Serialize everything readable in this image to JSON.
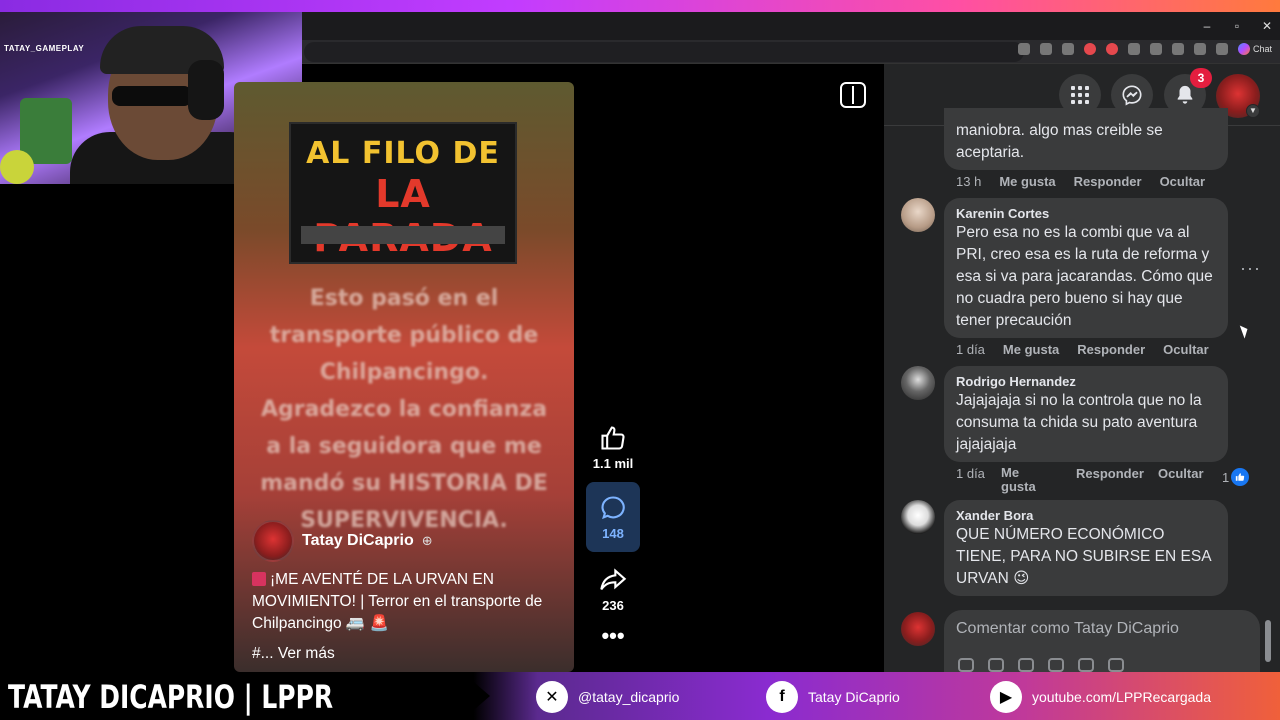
{
  "window": {
    "minimize": "–",
    "restore": "▫",
    "close": "✕"
  },
  "browser": {
    "chat_label": "Chat"
  },
  "webcam": {
    "label": "TATAY_GAMEPLAY"
  },
  "post": {
    "poster_line1": "AL FILO DE",
    "poster_line2": "LA PARADA",
    "overlay_text": "Esto pasó en el transporte público de Chilpancingo. Agradezco la confianza a la seguidora que me mandó su HISTORIA DE SUPERVIVENCIA.",
    "author": "Tatay DiCaprio",
    "caption": "¡ME AVENTÉ DE LA URVAN EN MOVIMIENTO! | Terror en el transporte de Chilpancingo 🚐 🚨",
    "see_more": "#... Ver más",
    "likes": "1.1 mil",
    "comments": "148",
    "shares": "236",
    "more_dots": "•••"
  },
  "header": {
    "notifications_badge": "3"
  },
  "comments": [
    {
      "name": "",
      "text": "maniobra. algo mas creible se aceptaria.",
      "time": "13 h",
      "like": "Me gusta",
      "reply": "Responder",
      "hide": "Ocultar"
    },
    {
      "name": "Karenin Cortes",
      "text": "Pero esa no es la combi que va al PRI, creo esa es la ruta de reforma y esa si va para jacarandas. Cómo que no cuadra pero bueno si hay que tener precaución",
      "time": "1 día",
      "like": "Me gusta",
      "reply": "Responder",
      "hide": "Ocultar"
    },
    {
      "name": "Rodrigo Hernandez",
      "text": "Jajajajaja si no la controla que no la consuma ta chida su pato aventura jajajajaja",
      "time": "1 día",
      "like": "Me gusta",
      "reply": "Responder",
      "hide": "Ocultar",
      "reactions": "1"
    },
    {
      "name": "Xander Bora",
      "text": "QUE NÚMERO ECONÓMICO TIENE, PARA NO SUBIRSE EN ESA URVAN 😉"
    }
  ],
  "composer": {
    "placeholder": "Comentar como Tatay DiCaprio"
  },
  "banner": {
    "title": "TATAY DICAPRIO | LPPR",
    "x_handle": "@tatay_dicaprio",
    "facebook": "Tatay DiCaprio",
    "youtube": "youtube.com/LPPRecargada"
  },
  "colors": {
    "accent": "#1877f2",
    "panel": "#242526",
    "bubble": "#3a3b3c",
    "badge": "#e41e3f"
  }
}
